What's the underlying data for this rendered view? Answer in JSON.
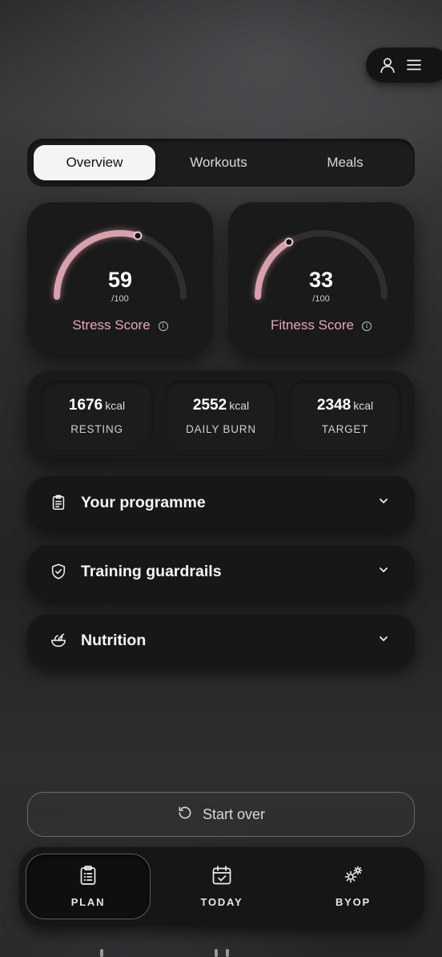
{
  "header": {
    "profile_icon": "user-icon",
    "menu_icon": "hamburger-menu-icon"
  },
  "tabs": [
    {
      "label": "Overview",
      "active": true
    },
    {
      "label": "Workouts",
      "active": false
    },
    {
      "label": "Meals",
      "active": false
    }
  ],
  "scores": {
    "stress": {
      "value": "59",
      "max": "/100",
      "label": "Stress Score",
      "level": 59
    },
    "fitness": {
      "value": "33",
      "max": "/100",
      "label": "Fitness Score",
      "level": 33
    }
  },
  "calories": [
    {
      "value": "1676",
      "unit": "kcal",
      "label": "RESTING"
    },
    {
      "value": "2552",
      "unit": "kcal",
      "label": "DAILY BURN"
    },
    {
      "value": "2348",
      "unit": "kcal",
      "label": "TARGET"
    }
  ],
  "sections": [
    {
      "title": "Your programme",
      "icon": "clipboard-icon"
    },
    {
      "title": "Training guardrails",
      "icon": "shield-check-icon"
    },
    {
      "title": "Nutrition",
      "icon": "salad-bowl-icon"
    }
  ],
  "start_over": {
    "label": "Start over",
    "icon": "rotate-ccw-icon"
  },
  "nav": [
    {
      "label": "PLAN",
      "icon": "clipboard-list-icon",
      "active": true
    },
    {
      "label": "TODAY",
      "icon": "calendar-check-icon",
      "active": false
    },
    {
      "label": "BYOP",
      "icon": "gears-icon",
      "active": false
    }
  ],
  "colors": {
    "accent_pink": "#e7a7b4",
    "card_bg": "#1a1a1b"
  }
}
